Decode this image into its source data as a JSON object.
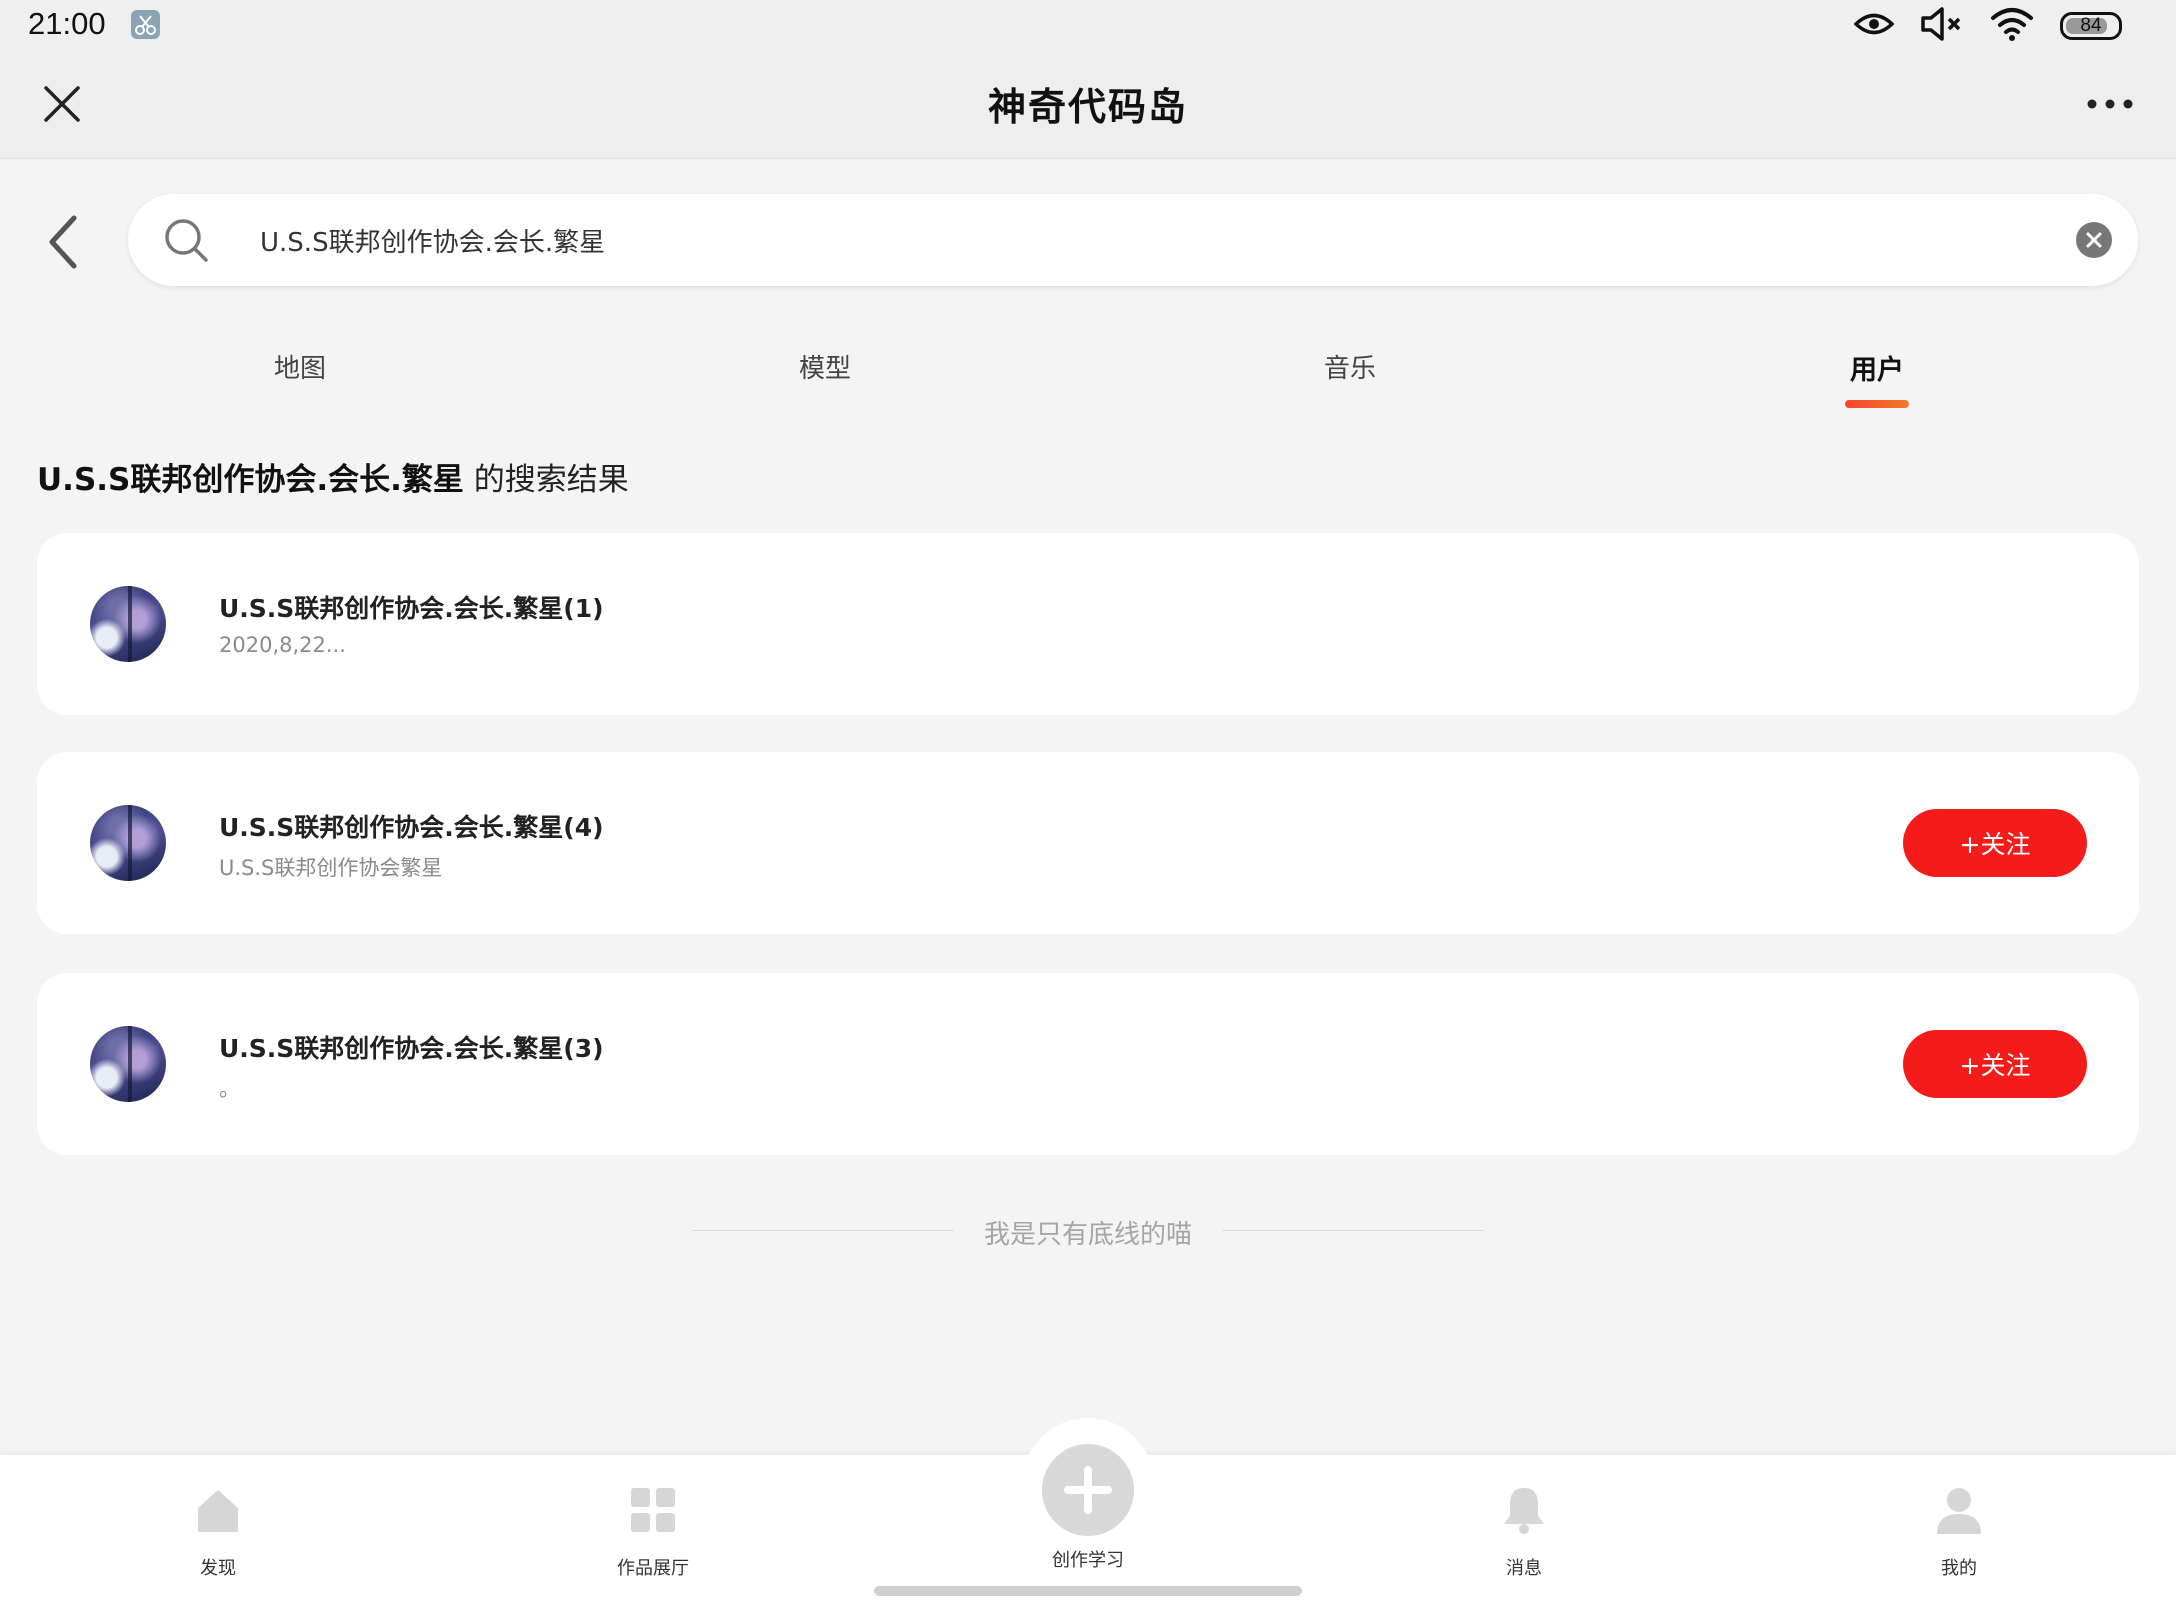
{
  "status_bar": {
    "time": "21:00",
    "battery": "84",
    "battery_level_percent": 84,
    "icons": [
      "eye-icon",
      "volume-muted-icon",
      "wifi-icon",
      "battery-icon"
    ]
  },
  "title_bar": {
    "title": "神奇代码岛"
  },
  "search": {
    "value": "U.S.S联邦创作协会.会长.繁星"
  },
  "tabs": [
    {
      "label": "地图",
      "active": false
    },
    {
      "label": "模型",
      "active": false
    },
    {
      "label": "音乐",
      "active": false
    },
    {
      "label": "用户",
      "active": true
    }
  ],
  "results": {
    "query": "U.S.S联邦创作协会.会长.繁星",
    "suffix": " 的搜索结果",
    "items": [
      {
        "name": "U.S.S联邦创作协会.会长.繁星(1)",
        "subtitle": "2020,8,22...",
        "follow_label": ""
      },
      {
        "name": "U.S.S联邦创作协会.会长.繁星(4)",
        "subtitle": "U.S.S联邦创作协会繁星",
        "follow_label": "+关注"
      },
      {
        "name": "U.S.S联邦创作协会.会长.繁星(3)",
        "subtitle": "。",
        "follow_label": "+关注"
      }
    ]
  },
  "footer_text": "我是只有底线的喵",
  "bottom_nav": [
    {
      "label": "发现",
      "icon": "home-icon"
    },
    {
      "label": "作品展厅",
      "icon": "grid-icon"
    },
    {
      "label": "创作学习",
      "icon": "plus-icon"
    },
    {
      "label": "消息",
      "icon": "bell-icon"
    },
    {
      "label": "我的",
      "icon": "person-icon"
    }
  ],
  "colors": {
    "accent_red": "#f41b1b",
    "tab_underline": "#f5452c",
    "background": "#f4f4f4"
  }
}
